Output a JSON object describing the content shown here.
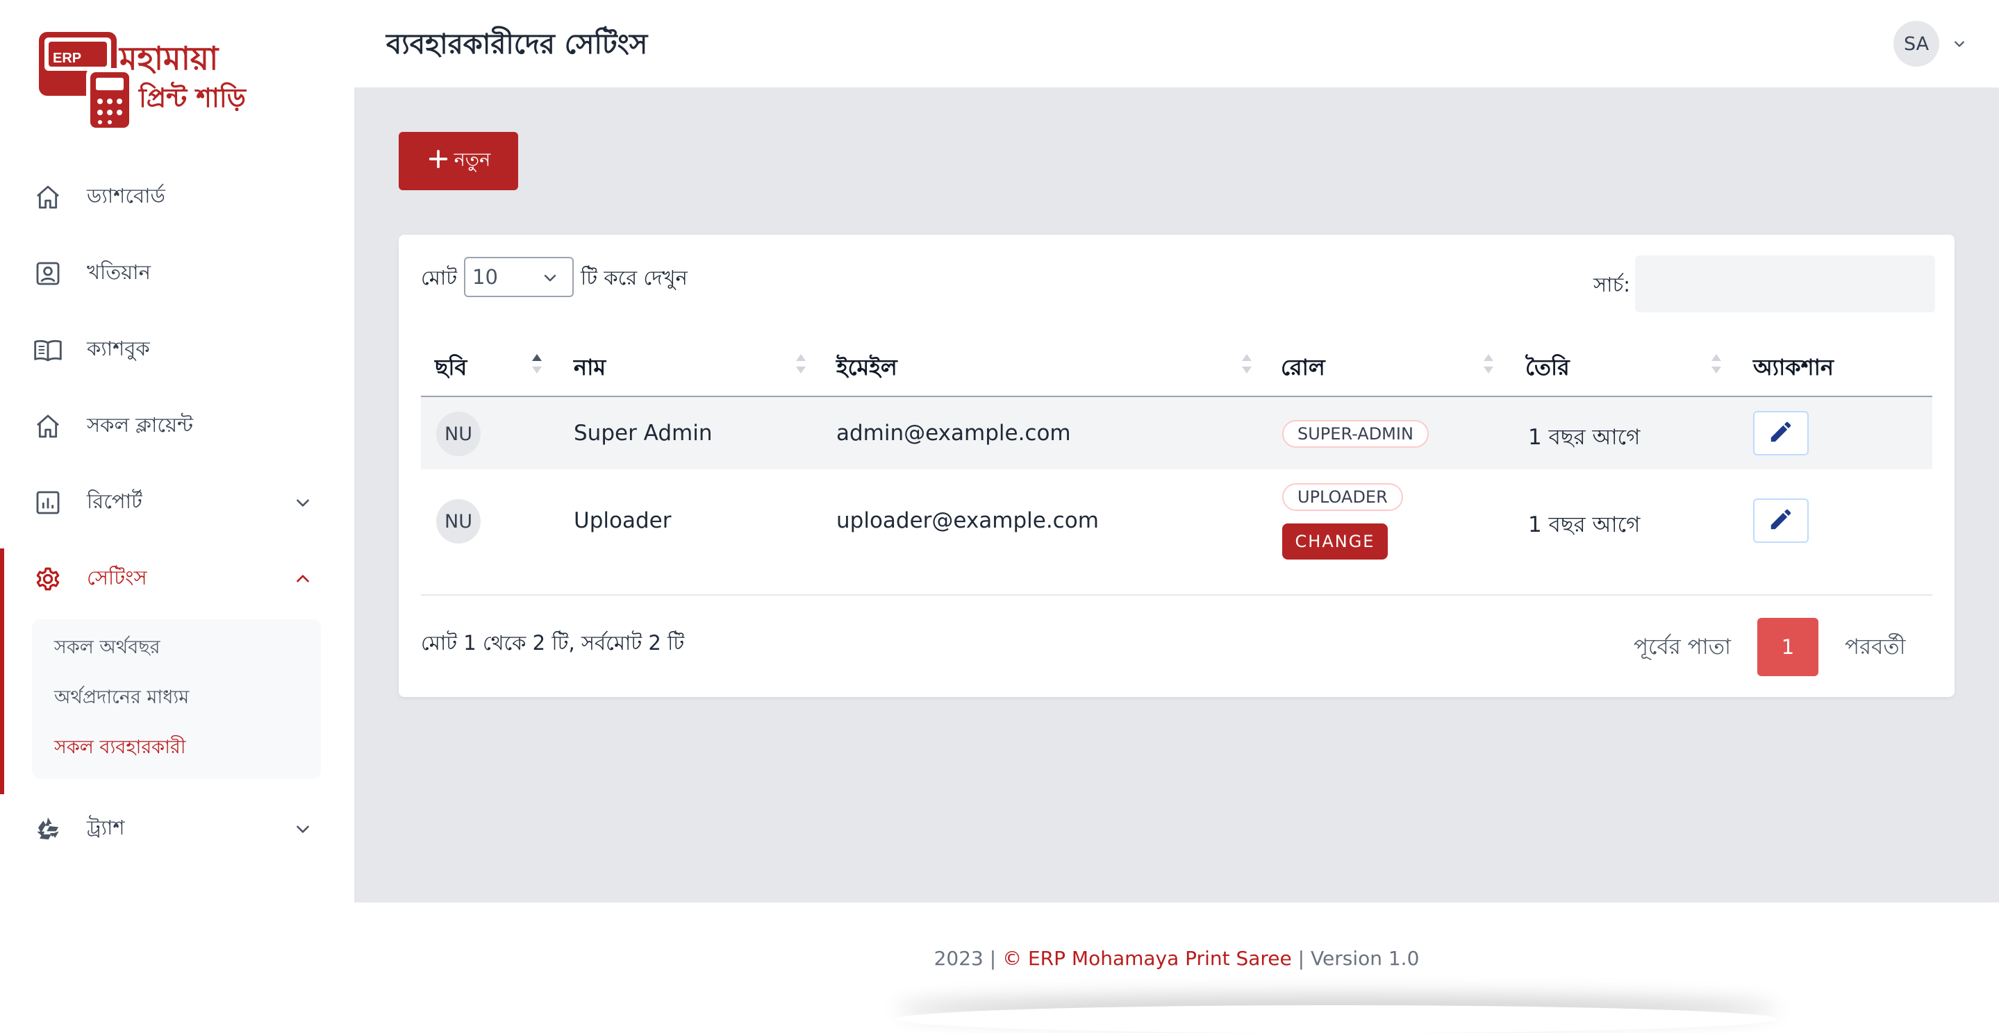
{
  "colors": {
    "accent": "#b91c1c",
    "button": "#b52424",
    "page_active": "#e05252",
    "main_bg": "#e5e7eb"
  },
  "logo": {
    "badge": "ERP",
    "line1": "মহামায়া",
    "line2": "প্রিন্ট শাড়ি"
  },
  "sidebar": {
    "items": [
      {
        "label": "ড্যাশবোর্ড",
        "icon": "home-icon"
      },
      {
        "label": "খতিয়ান",
        "icon": "user-square-icon"
      },
      {
        "label": "ক্যাশবুক",
        "icon": "book-icon"
      },
      {
        "label": "সকল ক্লায়েন্ট",
        "icon": "home-icon"
      },
      {
        "label": "রিপোর্ট",
        "icon": "chart-icon"
      },
      {
        "label": "সেটিংস",
        "icon": "gear-icon"
      },
      {
        "label": "ট্র্যাশ",
        "icon": "recycle-icon"
      }
    ],
    "settings_submenu": [
      "সকল অর্থবছর",
      "অর্থপ্রদানের মাধ্যম",
      "সকল ব্যবহারকারী"
    ]
  },
  "header": {
    "title": "ব্যবহারকারীদের সেটিংস",
    "avatar": "SA"
  },
  "toolbar": {
    "new_label": "নতুন"
  },
  "table_controls": {
    "show_prefix": "মোট",
    "page_length": "10",
    "show_suffix": "টি করে দেখুন",
    "search_label": "সার্চ:"
  },
  "table": {
    "columns": [
      "ছবি",
      "নাম",
      "ইমেইল",
      "রোল",
      "তৈরি",
      "অ্যাকশান"
    ],
    "rows": [
      {
        "avatar": "NU",
        "name": "Super Admin",
        "email": "admin@example.com",
        "role": "SUPER-ADMIN",
        "created": "1 বছর আগে"
      },
      {
        "avatar": "NU",
        "name": "Uploader",
        "email": "uploader@example.com",
        "role": "UPLOADER",
        "role_action": "CHANGE",
        "created": "1 বছর আগে"
      }
    ]
  },
  "pagination": {
    "info": "মোট 1 থেকে 2 টি, সর্বমোট 2 টি",
    "prev": "পূর্বের পাতা",
    "current": "1",
    "next": "পরবর্তী"
  },
  "footer": {
    "year": "2023 |",
    "brand": "© ERP Mohamaya Print Saree",
    "version": "| Version 1.0"
  }
}
